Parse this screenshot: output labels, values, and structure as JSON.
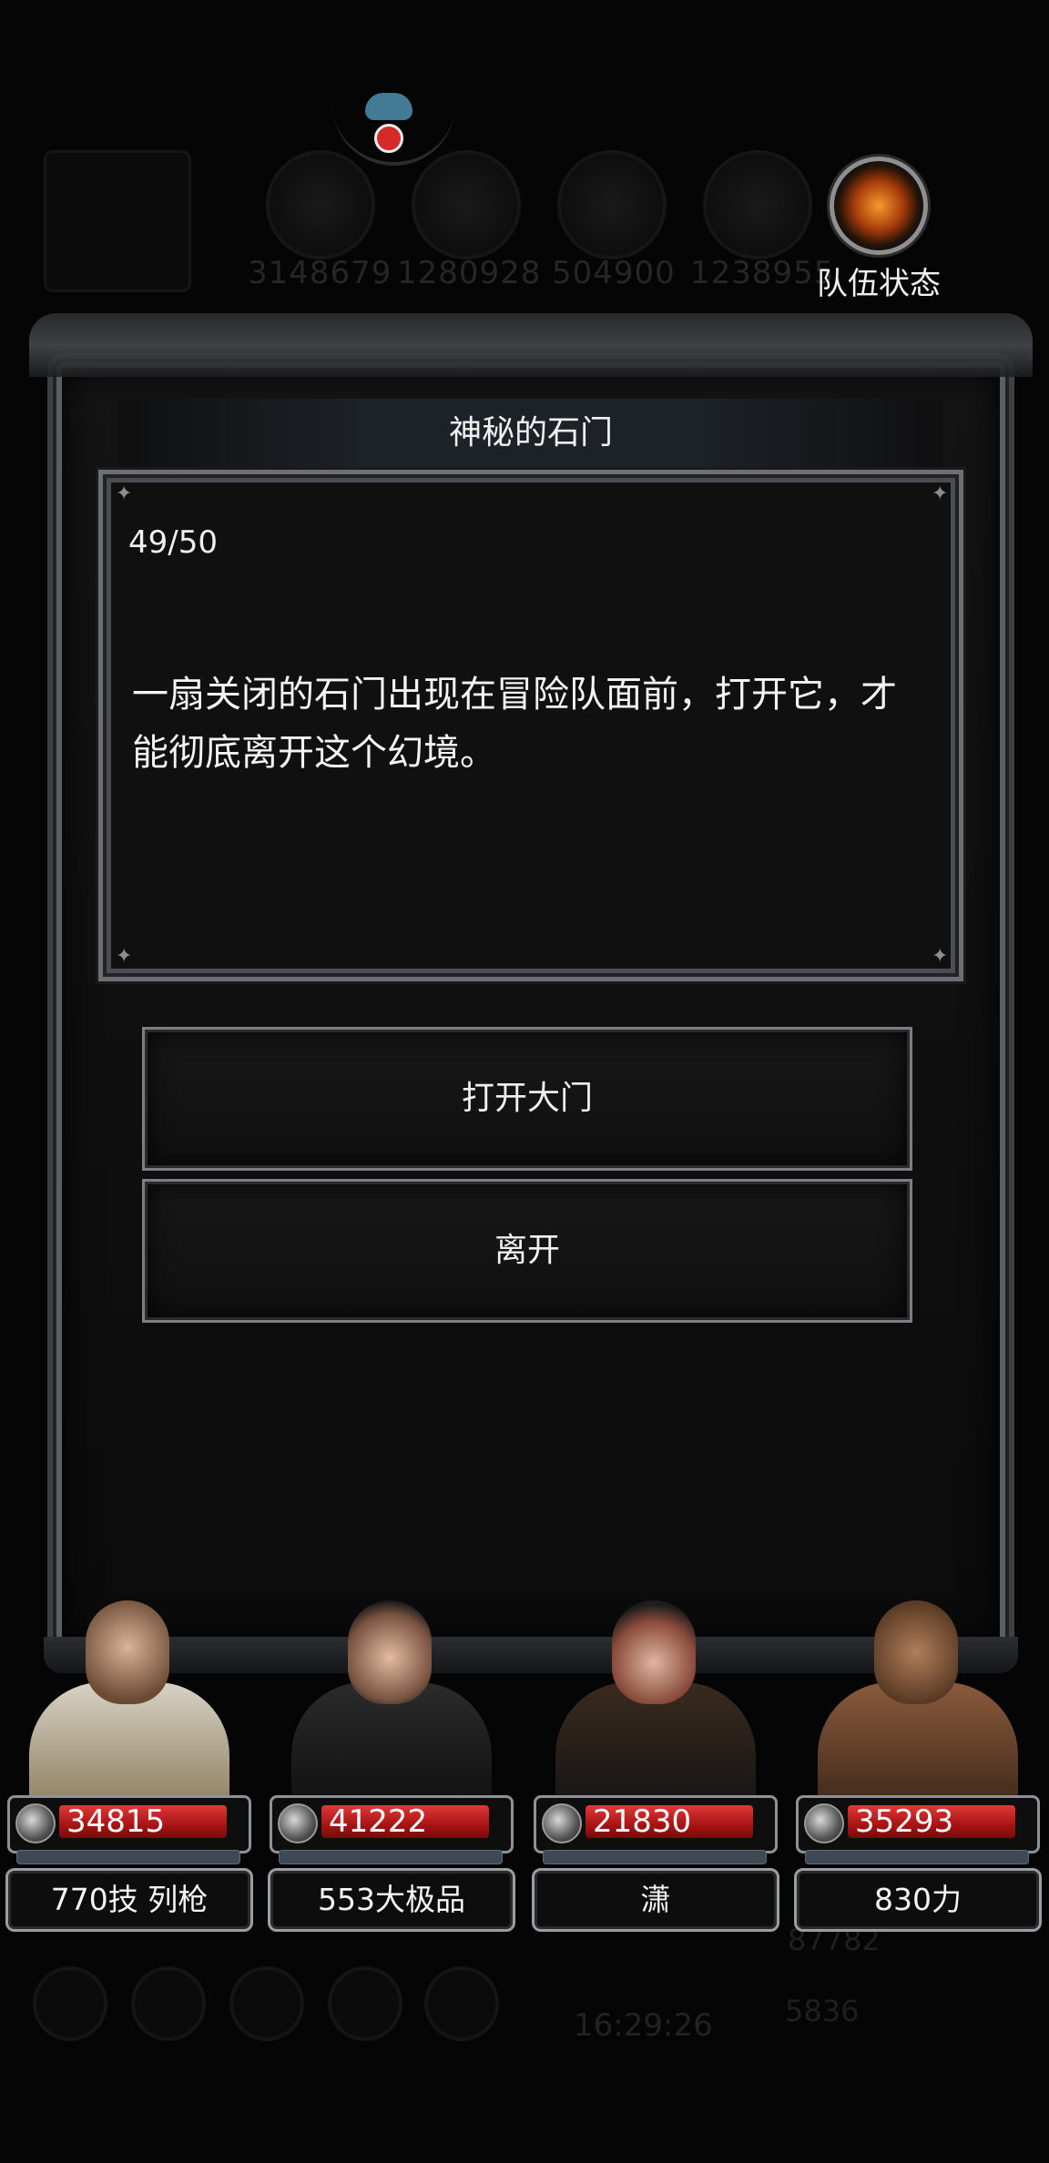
{
  "background": {
    "resource_numbers": [
      "3148679",
      "1280928",
      "504900",
      "1238955"
    ],
    "timer": "16:29:26",
    "counts": [
      "87782",
      "5836"
    ]
  },
  "hud": {
    "team_status_label": "队伍状态"
  },
  "dialog": {
    "title": "神秘的石门",
    "progress": "49/50",
    "text": "一扇关闭的石门出现在冒险队面前，打开它，才能彻底离开这个幻境。",
    "choices": [
      {
        "label": "打开大门"
      },
      {
        "label": "离开"
      }
    ]
  },
  "heroes": [
    {
      "hp": "34815",
      "hp_fraction": 0.92,
      "name": "770技 列枪"
    },
    {
      "hp": "41222",
      "hp_fraction": 0.92,
      "name": "553大极品"
    },
    {
      "hp": "21830",
      "hp_fraction": 0.92,
      "name": "潇"
    },
    {
      "hp": "35293",
      "hp_fraction": 0.92,
      "name": "830力"
    }
  ],
  "colors": {
    "hp_red": "#c41f1f",
    "frame_silver": "#7b7f84",
    "background": "#050505"
  }
}
